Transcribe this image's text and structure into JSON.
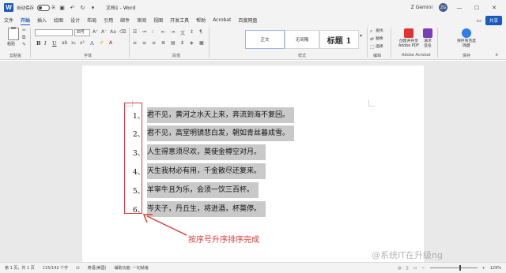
{
  "titlebar": {
    "app_logo": "W",
    "autosave_label": "自动保存",
    "autosave_state": "关",
    "doc_title": "文档1 - Word",
    "user_name": "Z Gemini",
    "user_initials": "ZG",
    "quick_access_icons": [
      "save-icon",
      "undo-icon",
      "redo-icon",
      "customize-icon"
    ],
    "window_buttons": [
      "minimize-icon",
      "maximize-icon",
      "close-icon"
    ]
  },
  "tabs": {
    "items": [
      "文件",
      "开始",
      "插入",
      "绘图",
      "设计",
      "布局",
      "引用",
      "邮件",
      "审阅",
      "视图",
      "开发工具",
      "帮助",
      "Acrobat",
      "百度网盘"
    ],
    "active": "开始",
    "share_label": "共享"
  },
  "ribbon": {
    "paste_label": "粘贴",
    "clipboard_label": "剪贴板",
    "font_group_label": "字体",
    "paragraph_group_label": "段落",
    "styles_group_label": "样式",
    "editing_group_label": "编辑",
    "acrobat_group_label": "Adobe Acrobat",
    "save_group_label": "保存",
    "font_name": "",
    "font_size": "四号",
    "format_buttons": [
      "B",
      "I",
      "U",
      "A"
    ],
    "styles": [
      {
        "label": "正文"
      },
      {
        "label": "无间隔"
      },
      {
        "label": "标题 1"
      }
    ],
    "editing_items": [
      "查找",
      "替换",
      "选择"
    ],
    "acrobat_items": [
      "创建并共享 Adobe PDF",
      "请求签名"
    ],
    "save_items": [
      "保存到百度网盘"
    ]
  },
  "document": {
    "lines": [
      {
        "num": "1、",
        "text": "君不见，黄河之水天上来，奔流到海不复回。"
      },
      {
        "num": "2、",
        "text": "君不见，高堂明镜悲白发，朝如青丝暮成雪。"
      },
      {
        "num": "3、",
        "text": "人生得意须尽欢，莫使金樽空对月。"
      },
      {
        "num": "4、",
        "text": "天生我材必有用，千金散尽还复来。"
      },
      {
        "num": "5、",
        "text": "羊宰牛且为乐，会须一饮三百杯。"
      },
      {
        "num": "6、",
        "text": "岑夫子，丹丘生，将进酒，杯莫停。"
      }
    ],
    "annotation": "按序号升序排序完成",
    "highlight_color": "#c9c9c9",
    "annotation_color": "#e03a3a"
  },
  "statusbar": {
    "page": "第 1 页，共 1 页",
    "words": "115/142 个字",
    "language": "英语(美国)",
    "accessibility": "辅助功能: 一切就绪",
    "zoom_percent": "129%",
    "zoom_level": 0.62
  },
  "watermark": "@系统IT在升级ng"
}
